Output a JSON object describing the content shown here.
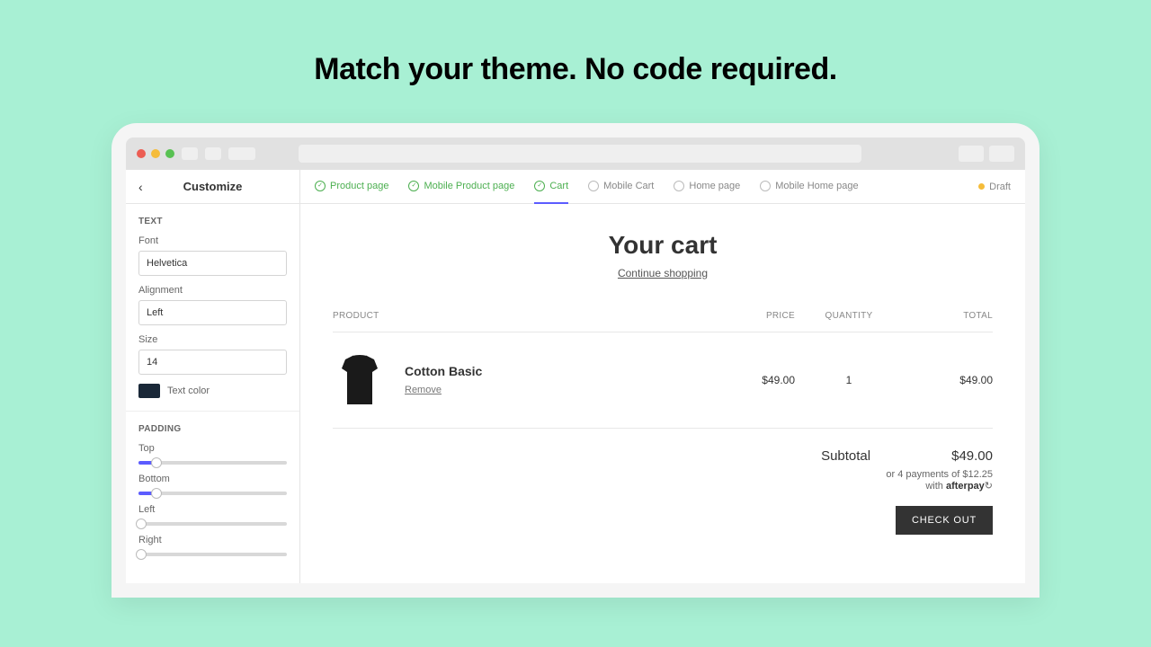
{
  "hero": "Match your theme. No code required.",
  "sidebar": {
    "title": "Customize",
    "text_section": {
      "heading": "TEXT",
      "font_label": "Font",
      "font_value": "Helvetica",
      "alignment_label": "Alignment",
      "alignment_value": "Left",
      "size_label": "Size",
      "size_value": "14",
      "color_label": "Text color",
      "color_value": "#1a2838"
    },
    "padding_section": {
      "heading": "PADDING",
      "top_label": "Top",
      "top_value": 12,
      "bottom_label": "Bottom",
      "bottom_value": 12,
      "left_label": "Left",
      "left_value": 2,
      "right_label": "Right",
      "right_value": 2
    }
  },
  "tabs": [
    {
      "label": "Product page",
      "state": "done"
    },
    {
      "label": "Mobile Product page",
      "state": "done"
    },
    {
      "label": "Cart",
      "state": "active"
    },
    {
      "label": "Mobile Cart",
      "state": ""
    },
    {
      "label": "Home page",
      "state": ""
    },
    {
      "label": "Mobile Home page",
      "state": ""
    }
  ],
  "draft_label": "Draft",
  "cart": {
    "title": "Your cart",
    "continue_label": "Continue shopping",
    "columns": {
      "product": "PRODUCT",
      "price": "PRICE",
      "quantity": "QUANTITY",
      "total": "TOTAL"
    },
    "items": [
      {
        "name": "Cotton Basic",
        "remove": "Remove",
        "price": "$49.00",
        "qty": "1",
        "total": "$49.00"
      }
    ],
    "subtotal_label": "Subtotal",
    "subtotal_value": "$49.00",
    "afterpay_prefix": "or 4 payments of $12.25",
    "afterpay_with": "with",
    "afterpay_brand": "afterpay",
    "checkout_label": "CHECK OUT"
  }
}
